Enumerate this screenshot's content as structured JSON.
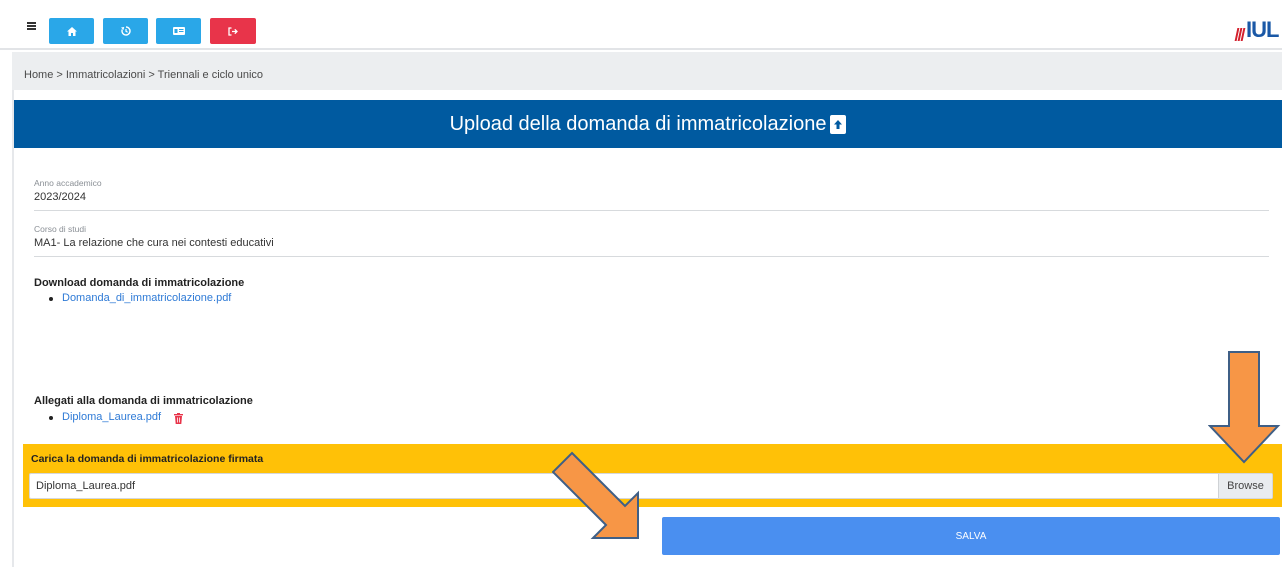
{
  "toolbar": {
    "menu_icon": "hamburger-icon",
    "buttons": [
      {
        "icon": "home-icon",
        "color": "#2aa7e8"
      },
      {
        "icon": "history-icon",
        "color": "#2aa7e8"
      },
      {
        "icon": "id-card-icon",
        "color": "#2aa7e8"
      },
      {
        "icon": "logout-icon",
        "color": "#e8344a"
      }
    ],
    "logo_text": "IUL"
  },
  "breadcrumb": {
    "text": "Home > Immatricolazioni > Triennali e ciclo unico"
  },
  "panel": {
    "title": "Upload della domanda di immatricolazione",
    "title_icon": "file-upload-icon",
    "header_color": "#005aa0"
  },
  "fields": {
    "academic_year": {
      "label": "Anno accademico",
      "value": "2023/2024"
    },
    "course": {
      "label": "Corso di studi",
      "value": "MA1- La relazione che cura nei contesti educativi"
    }
  },
  "download_section": {
    "title": "Download domanda di immatricolazione",
    "link": "Domanda_di_immatricolazione.pdf"
  },
  "attachments_section": {
    "title": "Allegati alla domanda di immatricolazione",
    "file": "Diploma_Laurea.pdf",
    "delete_icon": "trash-icon"
  },
  "upload": {
    "title": "Carica la domanda di immatricolazione firmata",
    "file_value": "Diploma_Laurea.pdf",
    "browse_label": "Browse",
    "box_color": "#ffc107"
  },
  "save_label": "SALVA",
  "annotations": {
    "arrow_color": "#f79646"
  }
}
